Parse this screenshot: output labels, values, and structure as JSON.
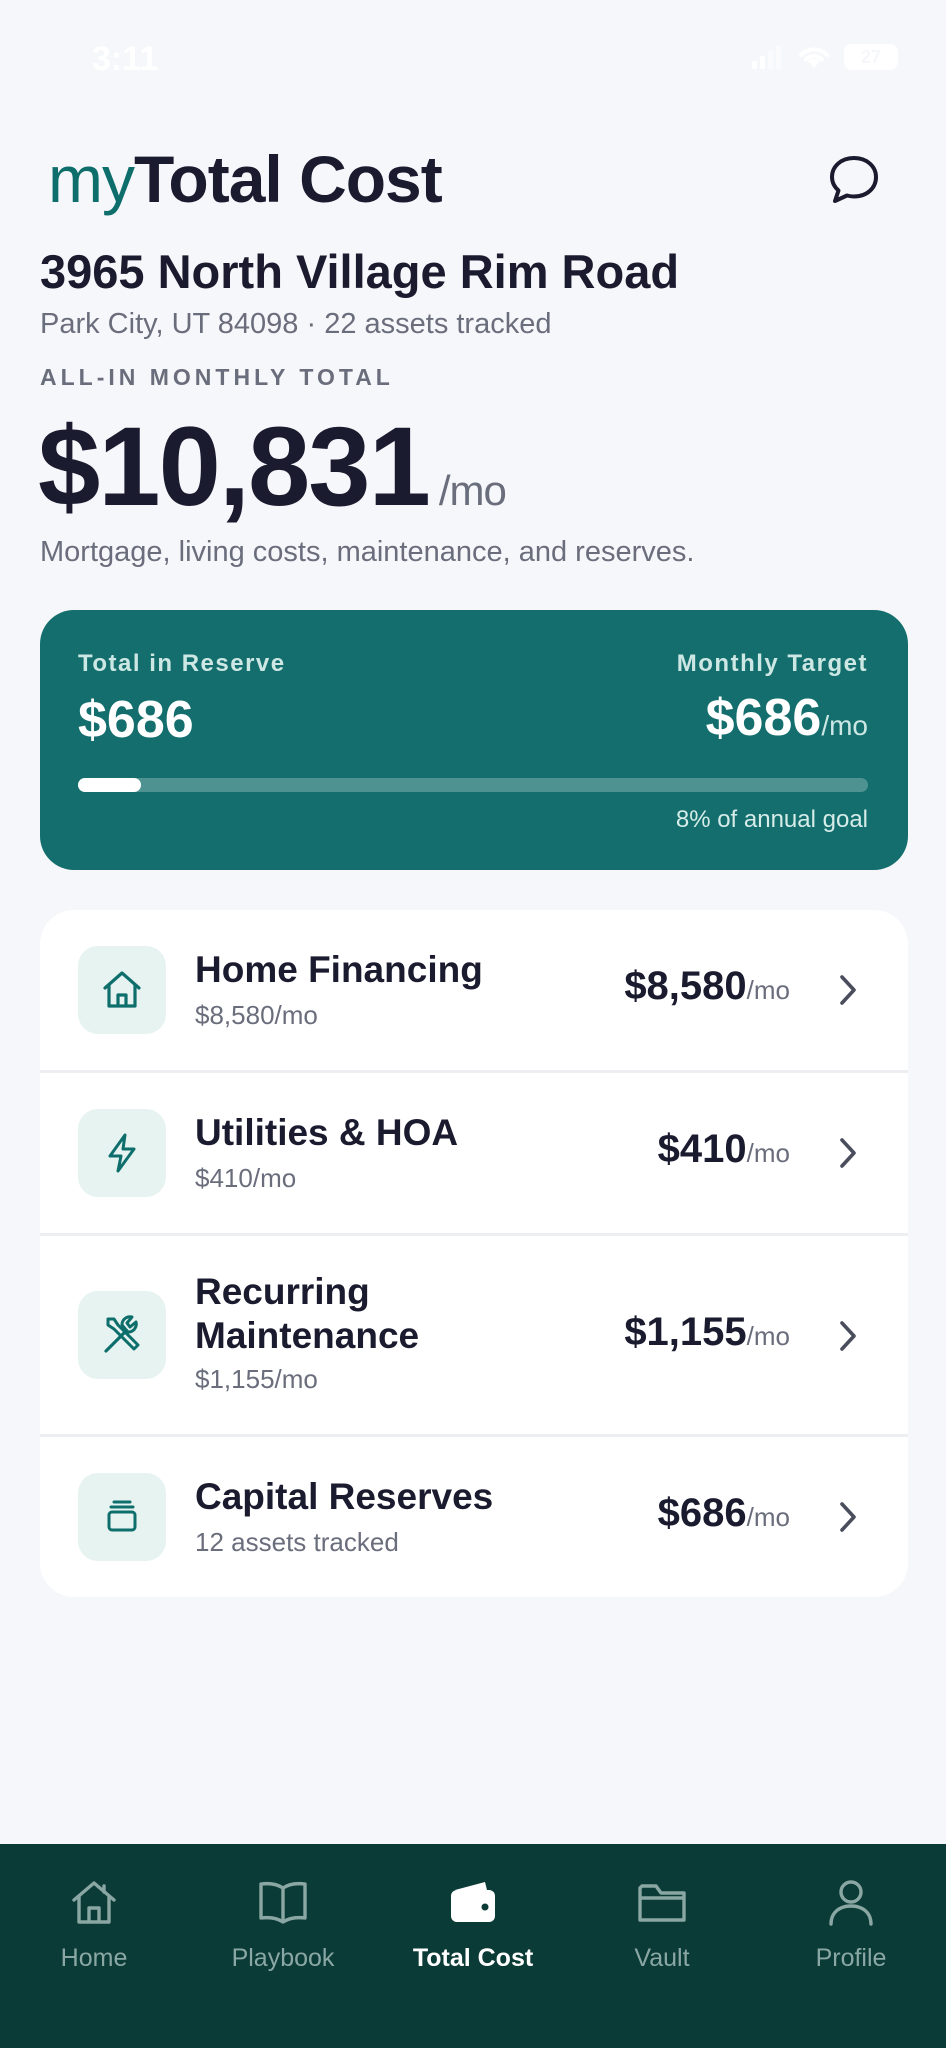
{
  "status_bar": {
    "time": "3:11",
    "battery": "27"
  },
  "header": {
    "brand_prefix": "my",
    "brand_name": "Total Cost",
    "chat_icon": "chat-bubble-icon"
  },
  "property": {
    "address": "3965 North Village Rim Road",
    "location": "Park City, UT 84098 · 22 assets tracked"
  },
  "summary": {
    "label": "ALL-IN MONTHLY TOTAL",
    "value": "$10,831",
    "unit": "/mo",
    "description": "Mortgage, living costs, maintenance, and reserves."
  },
  "reserve": {
    "total_label": "Total in Reserve",
    "total_value": "$686",
    "target_label": "Monthly Target",
    "target_value": "$686",
    "target_unit": "/mo",
    "progress_fraction": 0.08,
    "caption": "8% of annual goal",
    "colors": {
      "card": "#136E6D",
      "track": "#4E9391",
      "fill": "#FFFFFF"
    }
  },
  "cost_items": [
    {
      "icon": "house-icon",
      "title": "Home Financing",
      "subtitle": "$8,580/mo",
      "amount": "$8,580",
      "unit": "/mo"
    },
    {
      "icon": "lightning-icon",
      "title": "Utilities & HOA",
      "subtitle": "$410/mo",
      "amount": "$410",
      "unit": "/mo"
    },
    {
      "icon": "tools-icon",
      "title_line1": "Recurring",
      "title_line2": "Maintenance",
      "subtitle": "$1,155/mo",
      "amount": "$1,155",
      "unit": "/mo"
    },
    {
      "icon": "stack-icon",
      "title": "Capital Reserves",
      "subtitle": "12 assets tracked",
      "amount": "$686",
      "unit": "/mo"
    }
  ],
  "tab_bar": {
    "tabs": [
      {
        "label": "Home",
        "icon": "home-icon",
        "active": false
      },
      {
        "label": "Playbook",
        "icon": "book-icon",
        "active": false
      },
      {
        "label": "Total Cost",
        "icon": "wallet-icon",
        "active": true
      },
      {
        "label": "Vault",
        "icon": "folder-icon",
        "active": false
      },
      {
        "label": "Profile",
        "icon": "person-icon",
        "active": false
      }
    ]
  },
  "colors": {
    "brand_accent": "#0E6E6B",
    "tab_bar_bg": "#0B3B37",
    "page_bg": "#F6F7FA",
    "text_primary": "#1B1B2F",
    "text_secondary": "#6A6E7C"
  }
}
